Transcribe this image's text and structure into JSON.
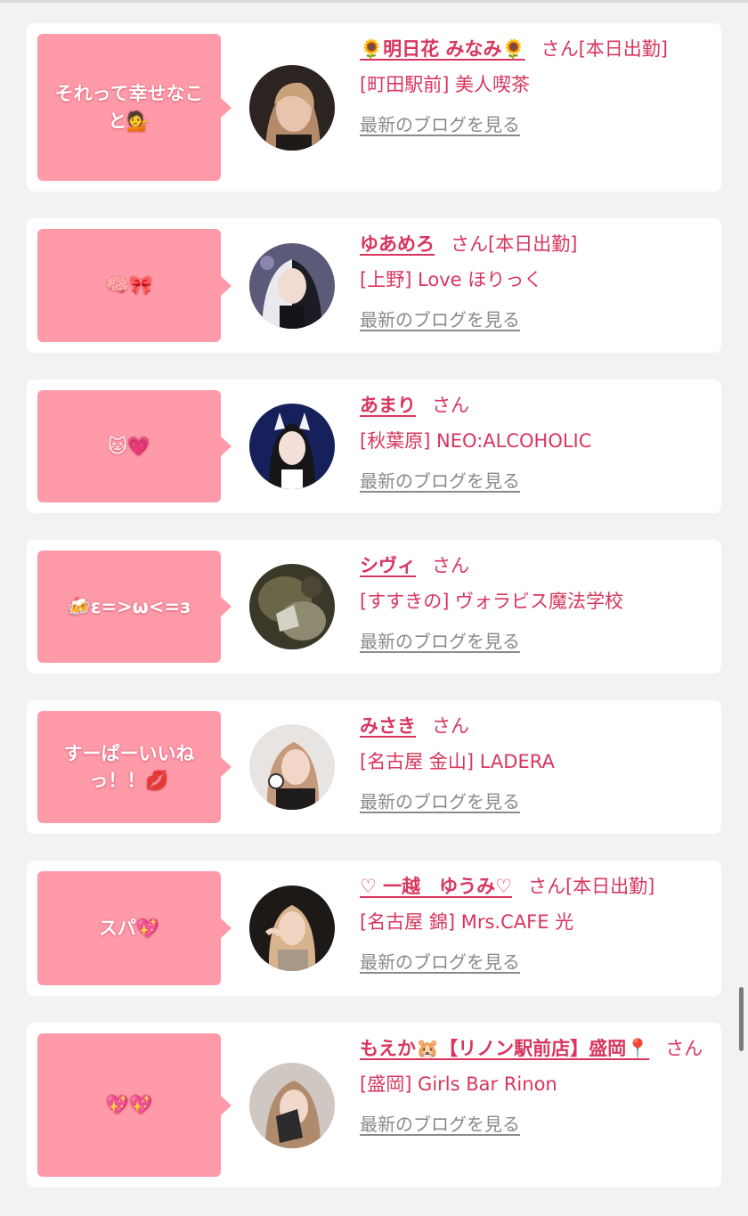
{
  "blog_link_label": "最新のブログを見る",
  "cards": [
    {
      "message": "それって幸せなこと💁",
      "name": "🌻明日花 みなみ🌻",
      "suffix": "さん[本日出勤]",
      "shop": "[町田駅前] 美人喫茶"
    },
    {
      "message": "🧠🎀",
      "name": "ゆあめろ",
      "suffix": "さん[本日出勤]",
      "shop": "[上野] Love ほりっく"
    },
    {
      "message": "🐱💗",
      "name": "あまり",
      "suffix": "さん",
      "shop": "[秋葉原] NEO:ALCOHOLIC"
    },
    {
      "message": "🍻ε=>ω<=з",
      "name": "シヴィ",
      "suffix": "さん",
      "shop": "[すすきの] ヴォラビス魔法学校"
    },
    {
      "message": "すーぱーいいねっ！！💋",
      "name": "みさき",
      "suffix": "さん",
      "shop": "[名古屋 金山] LADERA"
    },
    {
      "message": "スパ💖",
      "name": "♡ 一越　ゆうみ♡",
      "suffix": "さん[本日出勤]",
      "shop": "[名古屋 錦] Mrs.CAFE 光"
    },
    {
      "message": "💖💖",
      "name": "もえか🐹【リノン駅前店】盛岡📍",
      "suffix": "さん",
      "shop": "[盛岡] Girls Bar Rinon"
    }
  ],
  "colors": {
    "page_bg": "#f2f2f2",
    "card_bg": "#ffffff",
    "bubble_pink": "#ff9aa8",
    "accent": "#d8365e",
    "link_gray": "#8a8a8a"
  }
}
